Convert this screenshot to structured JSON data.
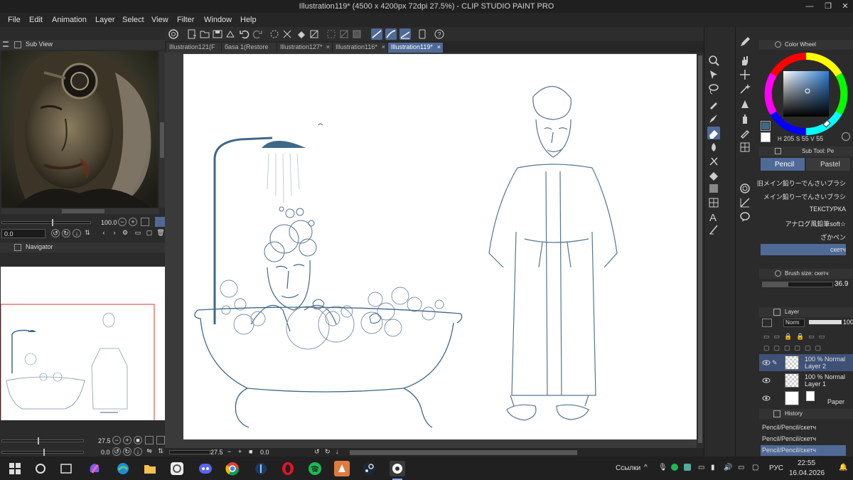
{
  "window": {
    "title": "Illustration119* (4500 x 4200px 72dpi 27.5%) - CLIP STUDIO PAINT PRO",
    "minimize": "—",
    "maximize": "❐",
    "close": "✕"
  },
  "menu": [
    "File",
    "Edit",
    "Animation",
    "Layer",
    "Select",
    "View",
    "Filter",
    "Window",
    "Help"
  ],
  "subview": {
    "title": "Sub View",
    "zoom": "100.0",
    "rotation": "0.0"
  },
  "navigator": {
    "title": "Navigator",
    "zoom": "27.5",
    "rotation": "0.0"
  },
  "tabs": [
    {
      "label": "Illustration121(F",
      "active": false
    },
    {
      "label": "баsa 1(Restore",
      "active": false
    },
    {
      "label": "Illustration127*",
      "active": false
    },
    {
      "label": "Illustration116*",
      "active": false
    },
    {
      "label": "Illustration119*",
      "active": true
    }
  ],
  "canvas_status": {
    "zoom": "27.5",
    "rotation": "0.0"
  },
  "color_wheel": {
    "title": "Color Wheel",
    "h": "205",
    "s": "55",
    "v": "55",
    "current_color": "#3f6888"
  },
  "subtool": {
    "title": "Sub Tool: Pe",
    "tabs": [
      {
        "label": "Pencil",
        "active": true
      },
      {
        "label": "Pastel",
        "active": false
      }
    ],
    "brushes": [
      {
        "label": "旧メイン鉛りーでんさいブラシ",
        "active": false
      },
      {
        "label": "メイン鉛りーでんさいブラシ",
        "active": false
      },
      {
        "label": "ТЕКСТУРКА",
        "active": false
      },
      {
        "label": "アナログ風鉛筆soft☆",
        "active": false
      },
      {
        "label": "ざかペン",
        "active": false
      },
      {
        "label": "скетч",
        "active": true
      }
    ]
  },
  "brush_size": {
    "title": "Brush size: скетч",
    "value": "36.9",
    "fraction": 0.37
  },
  "layer": {
    "title": "Layer",
    "blend_mode": "Norm",
    "opacity": "100",
    "layers": [
      {
        "opacity_mode": "100 % Normal",
        "name": "Layer 2",
        "active": true
      },
      {
        "opacity_mode": "100 % Normal",
        "name": "Layer 1",
        "active": false
      },
      {
        "opacity_mode": "",
        "name": "Paper",
        "active": false
      }
    ]
  },
  "history": {
    "title": "History",
    "items": [
      {
        "label": "Pencil/Pencil/скетч",
        "active": false
      },
      {
        "label": "Pencil/Pencil/скетч",
        "active": false
      },
      {
        "label": "Pencil/Pencil/скетч",
        "active": true
      }
    ]
  },
  "taskbar": {
    "links": "Ссылки",
    "lang": "РУС",
    "time": "22:55",
    "date": "16.04.2026"
  },
  "colors": {
    "ink": "#3f6888",
    "accent": "#4f6a96"
  }
}
